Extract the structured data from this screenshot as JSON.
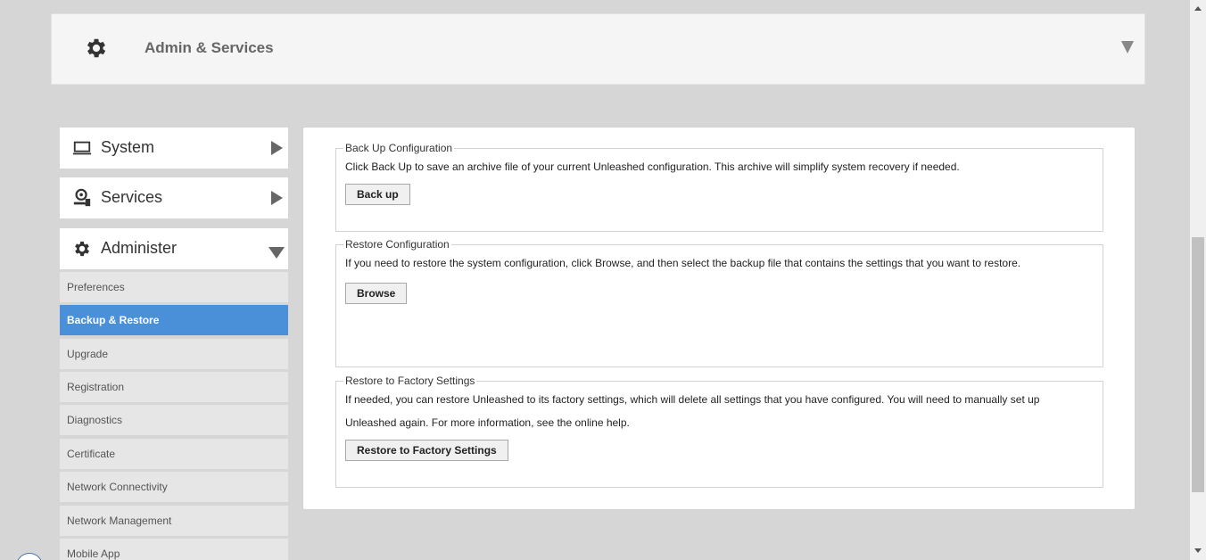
{
  "header": {
    "title": "Admin & Services"
  },
  "sidebar": {
    "sections": [
      {
        "label": "System",
        "state": "collapsed",
        "icon": "laptop-icon"
      },
      {
        "label": "Services",
        "state": "collapsed",
        "icon": "services-icon"
      },
      {
        "label": "Administer",
        "state": "expanded",
        "icon": "gear-icon"
      }
    ],
    "items": [
      {
        "label": "Preferences",
        "active": false
      },
      {
        "label": "Backup & Restore",
        "active": true
      },
      {
        "label": "Upgrade",
        "active": false
      },
      {
        "label": "Registration",
        "active": false
      },
      {
        "label": "Diagnostics",
        "active": false
      },
      {
        "label": "Certificate",
        "active": false
      },
      {
        "label": "Network Connectivity",
        "active": false
      },
      {
        "label": "Network Management",
        "active": false
      },
      {
        "label": "Mobile App",
        "active": false
      }
    ]
  },
  "backup": {
    "legend": "Back Up Configuration",
    "desc": "Click Back Up to save an archive file of your current Unleashed configuration. This archive will simplify system recovery if needed.",
    "button": "Back up"
  },
  "restore": {
    "legend": "Restore Configuration",
    "desc": "If you need to restore the system configuration, click Browse, and then select the backup file that contains the settings that you want to restore.",
    "button": "Browse"
  },
  "factory": {
    "legend": "Restore to Factory Settings",
    "desc": "If needed, you can restore Unleashed to its factory settings, which will delete all settings that you have configured. You will need to manually set up Unleashed again. For more information, see the online help.",
    "button": "Restore to Factory Settings"
  },
  "colors": {
    "accent": "#4a90d9",
    "background": "#d6d6d6",
    "panel": "#ffffff"
  }
}
